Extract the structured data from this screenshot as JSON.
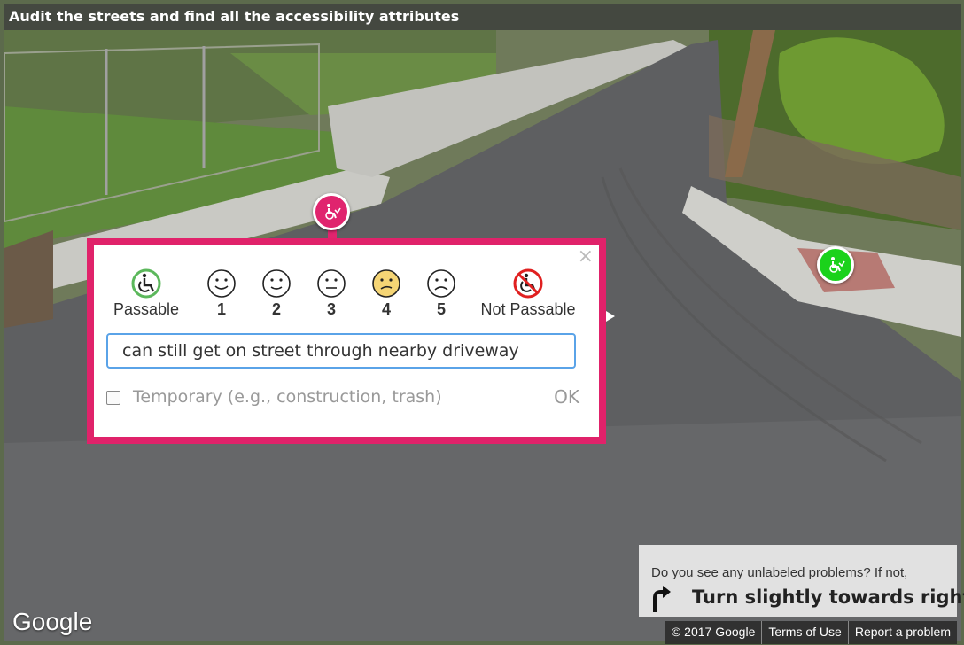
{
  "title": "Audit the streets and find all the accessibility attributes",
  "popup": {
    "close_label": "×",
    "ratings": [
      {
        "label": "Passable",
        "icon": "wheelchair-passable-icon",
        "color": "#5cb85c"
      },
      {
        "label": "1",
        "icon": "smile-face-icon"
      },
      {
        "label": "2",
        "icon": "smile-face-icon"
      },
      {
        "label": "3",
        "icon": "neutral-face-icon"
      },
      {
        "label": "4",
        "icon": "worried-face-icon",
        "color": "#f5d575"
      },
      {
        "label": "5",
        "icon": "frown-face-icon"
      },
      {
        "label": "Not Passable",
        "icon": "wheelchair-not-passable-icon",
        "color": "#e02020"
      }
    ],
    "comment_value": "can still get on street through nearby driveway",
    "temporary_label": "Temporary (e.g., construction, trash)",
    "temporary_checked": false,
    "ok_label": "OK"
  },
  "hint": {
    "question": "Do you see any unlabeled problems? If not,",
    "instruction": "Turn slightly towards right",
    "icon": "turn-right-arrow-icon"
  },
  "google_logo": "Google",
  "footer": {
    "copyright": "© 2017 Google",
    "terms": "Terms of Use",
    "report": "Report a problem"
  },
  "colors": {
    "accent": "#e0226a",
    "marker_green": "#1bd21b",
    "input_border": "#5aa3e8"
  }
}
